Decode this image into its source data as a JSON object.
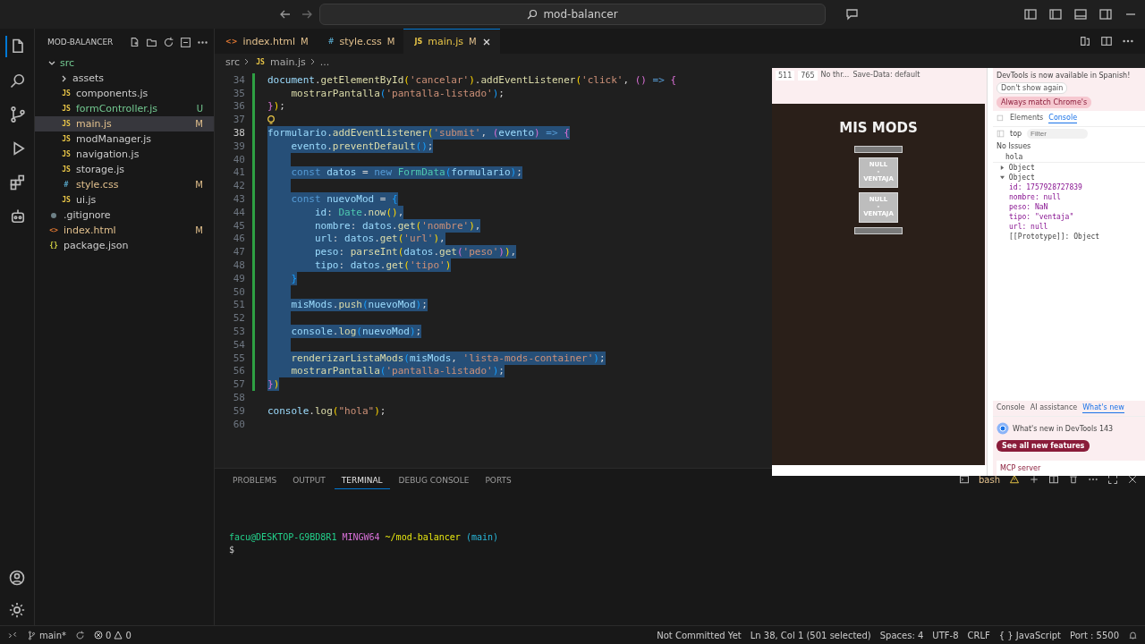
{
  "title_bar": {
    "search": "mod-balancer"
  },
  "activity_bar": {
    "items": [
      {
        "kind": "files",
        "selected": true
      },
      {
        "kind": "search",
        "selected": false
      },
      {
        "kind": "git",
        "selected": false
      },
      {
        "kind": "debug",
        "selected": false
      },
      {
        "kind": "extensions",
        "selected": false
      },
      {
        "kind": "remote",
        "selected": false
      }
    ]
  },
  "explorer": {
    "title": "MOD-BALANCER",
    "tree": [
      {
        "name": "src",
        "kind": "folder",
        "expanded": true,
        "color": "#73c991",
        "selected": false,
        "children": [
          {
            "name": "assets",
            "kind": "folder",
            "expanded": false,
            "color": "#cccccc",
            "selected": false
          },
          {
            "name": "components.js",
            "kind": "file",
            "icon": "JS",
            "color": "#cccccc",
            "selected": false
          },
          {
            "name": "formController.js",
            "kind": "file",
            "icon": "JS",
            "status": "U",
            "color": "#73c991",
            "selected": false
          },
          {
            "name": "main.js",
            "kind": "file",
            "icon": "JS",
            "status": "M",
            "color": "#e2c08d",
            "selected": true
          },
          {
            "name": "modManager.js",
            "kind": "file",
            "icon": "JS",
            "color": "#cccccc",
            "selected": false
          },
          {
            "name": "navigation.js",
            "kind": "file",
            "icon": "JS",
            "color": "#cccccc",
            "selected": false
          },
          {
            "name": "storage.js",
            "kind": "file",
            "icon": "JS",
            "color": "#cccccc",
            "selected": false
          },
          {
            "name": "style.css",
            "kind": "file",
            "icon": "#",
            "status": "M",
            "color": "#e2c08d",
            "selected": false
          },
          {
            "name": "ui.js",
            "kind": "file",
            "icon": "JS",
            "color": "#cccccc",
            "selected": false
          }
        ]
      },
      {
        "name": ".gitignore",
        "kind": "file",
        "color": "#cccccc",
        "selected": false
      },
      {
        "name": "index.html",
        "kind": "file",
        "icon": "<>",
        "status": "M",
        "color": "#e2c08d",
        "selected": false
      },
      {
        "name": "package.json",
        "kind": "file",
        "icon": "{}",
        "color": "#cccccc",
        "selected": false
      }
    ]
  },
  "tabs": [
    {
      "icon": "<>",
      "label": "index.html",
      "status": "M",
      "selected": false
    },
    {
      "icon": "#",
      "label": "style.css",
      "status": "M",
      "selected": false
    },
    {
      "icon": "JS",
      "label": "main.js",
      "status": "M",
      "selected": true
    }
  ],
  "breadcrumb": [
    {
      "label": "src"
    },
    {
      "icon": "JS",
      "label": "main.js"
    },
    {
      "label": "..."
    }
  ],
  "editor": {
    "lines": [
      {
        "number": "34",
        "selected": false,
        "tokens": [
          {
            "text": "document",
            "kind": "variable"
          },
          {
            "text": ".",
            "kind": "punctuation"
          },
          {
            "text": "getElementById",
            "kind": "function"
          },
          {
            "text": "(",
            "kind": "bracket1"
          },
          {
            "text": "'cancelar'",
            "kind": "string"
          },
          {
            "text": ")",
            "kind": "bracket1"
          },
          {
            "text": ".",
            "kind": "punctuation"
          },
          {
            "text": "addEventListener",
            "kind": "function"
          },
          {
            "text": "(",
            "kind": "bracket1"
          },
          {
            "text": "'click'",
            "kind": "string"
          },
          {
            "text": ", ",
            "kind": "punctuation"
          },
          {
            "text": "() ",
            "kind": "bracket2"
          },
          {
            "text": "=> ",
            "kind": "keyword"
          },
          {
            "text": "{",
            "kind": "bracket2"
          }
        ]
      },
      {
        "number": "35",
        "selected": false,
        "tokens": [
          {
            "text": "    mostrarPantalla",
            "kind": "function"
          },
          {
            "text": "(",
            "kind": "bracket3"
          },
          {
            "text": "'pantalla-listado'",
            "kind": "string"
          },
          {
            "text": ")",
            "kind": "bracket3"
          },
          {
            "text": ";",
            "kind": "punctuation"
          }
        ]
      },
      {
        "number": "36",
        "selected": false,
        "tokens": [
          {
            "text": "}",
            "kind": "bracket2"
          },
          {
            "text": ")",
            "kind": "bracket1"
          },
          {
            "text": ";",
            "kind": "punctuation"
          }
        ]
      },
      {
        "number": "37",
        "selected": false,
        "lightbulb": true
      },
      {
        "number": "38",
        "selected": true,
        "tokens": [
          {
            "text": "formulario",
            "kind": "variable"
          },
          {
            "text": ".",
            "kind": "punctuation"
          },
          {
            "text": "addEventListener",
            "kind": "function"
          },
          {
            "text": "(",
            "kind": "bracket1"
          },
          {
            "text": "'submit'",
            "kind": "string"
          },
          {
            "text": ", ",
            "kind": "punctuation"
          },
          {
            "text": "(",
            "kind": "bracket2"
          },
          {
            "text": "evento",
            "kind": "variable"
          },
          {
            "text": ") ",
            "kind": "bracket2"
          },
          {
            "text": "=> ",
            "kind": "keyword"
          },
          {
            "text": "{",
            "kind": "bracket2"
          }
        ]
      },
      {
        "number": "39",
        "selected": true,
        "tokens": [
          {
            "text": "    evento",
            "kind": "variable"
          },
          {
            "text": ".",
            "kind": "punctuation"
          },
          {
            "text": "preventDefault",
            "kind": "function"
          },
          {
            "text": "()",
            "kind": "bracket3"
          },
          {
            "text": ";",
            "kind": "punctuation"
          }
        ]
      },
      {
        "number": "40",
        "selected": true
      },
      {
        "number": "41",
        "selected": true,
        "tokens": [
          {
            "text": "    const ",
            "kind": "keyword"
          },
          {
            "text": "datos",
            "kind": "variable"
          },
          {
            "text": " = ",
            "kind": "punctuation"
          },
          {
            "text": "new ",
            "kind": "keyword"
          },
          {
            "text": "FormData",
            "kind": "class"
          },
          {
            "text": "(",
            "kind": "bracket3"
          },
          {
            "text": "formulario",
            "kind": "variable"
          },
          {
            "text": ")",
            "kind": "bracket3"
          },
          {
            "text": ";",
            "kind": "punctuation"
          }
        ]
      },
      {
        "number": "42",
        "selected": true
      },
      {
        "number": "43",
        "selected": true,
        "tokens": [
          {
            "text": "    const ",
            "kind": "keyword"
          },
          {
            "text": "nuevoMod",
            "kind": "variable"
          },
          {
            "text": " = ",
            "kind": "punctuation"
          },
          {
            "text": "{",
            "kind": "bracket3"
          }
        ]
      },
      {
        "number": "44",
        "selected": true,
        "tokens": [
          {
            "text": "        id",
            "kind": "variable"
          },
          {
            "text": ": ",
            "kind": "punctuation"
          },
          {
            "text": "Date",
            "kind": "class"
          },
          {
            "text": ".",
            "kind": "punctuation"
          },
          {
            "text": "now",
            "kind": "function"
          },
          {
            "text": "()",
            "kind": "bracket1"
          },
          {
            "text": ",",
            "kind": "punctuation"
          }
        ]
      },
      {
        "number": "45",
        "selected": true,
        "tokens": [
          {
            "text": "        nombre",
            "kind": "variable"
          },
          {
            "text": ": ",
            "kind": "punctuation"
          },
          {
            "text": "datos",
            "kind": "variable"
          },
          {
            "text": ".",
            "kind": "punctuation"
          },
          {
            "text": "get",
            "kind": "function"
          },
          {
            "text": "(",
            "kind": "bracket1"
          },
          {
            "text": "'nombre'",
            "kind": "string"
          },
          {
            "text": ")",
            "kind": "bracket1"
          },
          {
            "text": ",",
            "kind": "punctuation"
          }
        ]
      },
      {
        "number": "46",
        "selected": true,
        "tokens": [
          {
            "text": "        url",
            "kind": "variable"
          },
          {
            "text": ": ",
            "kind": "punctuation"
          },
          {
            "text": "datos",
            "kind": "variable"
          },
          {
            "text": ".",
            "kind": "punctuation"
          },
          {
            "text": "get",
            "kind": "function"
          },
          {
            "text": "(",
            "kind": "bracket1"
          },
          {
            "text": "'url'",
            "kind": "string"
          },
          {
            "text": ")",
            "kind": "bracket1"
          },
          {
            "text": ",",
            "kind": "punctuation"
          }
        ]
      },
      {
        "number": "47",
        "selected": true,
        "tokens": [
          {
            "text": "        peso",
            "kind": "variable"
          },
          {
            "text": ": ",
            "kind": "punctuation"
          },
          {
            "text": "parseInt",
            "kind": "function"
          },
          {
            "text": "(",
            "kind": "bracket1"
          },
          {
            "text": "datos",
            "kind": "variable"
          },
          {
            "text": ".",
            "kind": "punctuation"
          },
          {
            "text": "get",
            "kind": "function"
          },
          {
            "text": "(",
            "kind": "bracket2"
          },
          {
            "text": "'peso'",
            "kind": "string"
          },
          {
            "text": ")",
            "kind": "bracket2"
          },
          {
            "text": ")",
            "kind": "bracket1"
          },
          {
            "text": ",",
            "kind": "punctuation"
          }
        ]
      },
      {
        "number": "48",
        "selected": true,
        "tokens": [
          {
            "text": "        tipo",
            "kind": "variable"
          },
          {
            "text": ": ",
            "kind": "punctuation"
          },
          {
            "text": "datos",
            "kind": "variable"
          },
          {
            "text": ".",
            "kind": "punctuation"
          },
          {
            "text": "get",
            "kind": "function"
          },
          {
            "text": "(",
            "kind": "bracket1"
          },
          {
            "text": "'tipo'",
            "kind": "string"
          },
          {
            "text": ")",
            "kind": "bracket1"
          }
        ]
      },
      {
        "number": "49",
        "selected": true,
        "tokens": [
          {
            "text": "    }",
            "kind": "bracket3"
          }
        ]
      },
      {
        "number": "50",
        "selected": true
      },
      {
        "number": "51",
        "selected": true,
        "tokens": [
          {
            "text": "    misMods",
            "kind": "variable"
          },
          {
            "text": ".",
            "kind": "punctuation"
          },
          {
            "text": "push",
            "kind": "function"
          },
          {
            "text": "(",
            "kind": "bracket3"
          },
          {
            "text": "nuevoMod",
            "kind": "variable"
          },
          {
            "text": ")",
            "kind": "bracket3"
          },
          {
            "text": ";",
            "kind": "punctuation"
          }
        ]
      },
      {
        "number": "52",
        "selected": true
      },
      {
        "number": "53",
        "selected": true,
        "tokens": [
          {
            "text": "    console",
            "kind": "variable"
          },
          {
            "text": ".",
            "kind": "punctuation"
          },
          {
            "text": "log",
            "kind": "function"
          },
          {
            "text": "(",
            "kind": "bracket3"
          },
          {
            "text": "nuevoMod",
            "kind": "variable"
          },
          {
            "text": ")",
            "kind": "bracket3"
          },
          {
            "text": ";",
            "kind": "punctuation"
          }
        ]
      },
      {
        "number": "54",
        "selected": true
      },
      {
        "number": "55",
        "selected": true,
        "tokens": [
          {
            "text": "    renderizarListaMods",
            "kind": "function"
          },
          {
            "text": "(",
            "kind": "bracket3"
          },
          {
            "text": "misMods",
            "kind": "variable"
          },
          {
            "text": ", ",
            "kind": "punctuation"
          },
          {
            "text": "'lista-mods-container'",
            "kind": "string"
          },
          {
            "text": ")",
            "kind": "bracket3"
          },
          {
            "text": ";",
            "kind": "punctuation"
          }
        ]
      },
      {
        "number": "56",
        "selected": true,
        "tokens": [
          {
            "text": "    mostrarPantalla",
            "kind": "function"
          },
          {
            "text": "(",
            "kind": "bracket3"
          },
          {
            "text": "'pantalla-listado'",
            "kind": "string"
          },
          {
            "text": ")",
            "kind": "bracket3"
          },
          {
            "text": ";",
            "kind": "punctuation"
          }
        ]
      },
      {
        "number": "57",
        "selected": true,
        "tokens": [
          {
            "text": "}",
            "kind": "bracket2"
          },
          {
            "text": ")",
            "kind": "bracket1"
          }
        ]
      },
      {
        "number": "58",
        "selected": false
      },
      {
        "number": "59",
        "selected": false,
        "tokens": [
          {
            "text": "console",
            "kind": "variable"
          },
          {
            "text": ".",
            "kind": "punctuation"
          },
          {
            "text": "log",
            "kind": "function"
          },
          {
            "text": "(",
            "kind": "bracket1"
          },
          {
            "text": "\"hola\"",
            "kind": "string"
          },
          {
            "text": ")",
            "kind": "bracket1"
          },
          {
            "text": ";",
            "kind": "punctuation"
          }
        ]
      },
      {
        "number": "60",
        "selected": false
      }
    ]
  },
  "panel": {
    "tabs": [
      {
        "label": "PROBLEMS",
        "selected": false
      },
      {
        "label": "OUTPUT",
        "selected": false
      },
      {
        "label": "TERMINAL",
        "selected": true
      },
      {
        "label": "DEBUG CONSOLE",
        "selected": false
      },
      {
        "label": "PORTS",
        "selected": false
      }
    ],
    "shell": "bash",
    "prompt": [
      {
        "text": "facu@DESKTOP-G9BD8R1",
        "kind": "user"
      },
      {
        "text": "MINGW64",
        "kind": "system"
      },
      {
        "text": "~/mod-balancer",
        "kind": "path"
      },
      {
        "text": "(main)",
        "kind": "branch"
      }
    ],
    "cursor_line": "$"
  },
  "browser": {
    "toolbar": [
      {
        "kind": "field",
        "text": "511"
      },
      {
        "kind": "field",
        "text": "765"
      },
      {
        "kind": "menu",
        "text": "No thr..."
      },
      {
        "kind": "menu",
        "text": "Save-Data: default"
      }
    ],
    "page": {
      "title": "MIS MODS",
      "mods": [
        {
          "name": "NULL",
          "sep": "-",
          "type": "VENTAJA"
        },
        {
          "name": "NULL",
          "sep": "-",
          "type": "VENTAJA"
        }
      ]
    },
    "devtools": {
      "notice": "DevTools is now available in Spanish!",
      "notice_buttons": [
        {
          "label": "Don't show again",
          "kind": "plain"
        },
        {
          "label": "Always match Chrome's",
          "kind": "primary"
        }
      ],
      "tabs": [
        {
          "label": "Elements",
          "selected": false
        },
        {
          "label": "Console",
          "selected": true
        }
      ],
      "context": "top",
      "filter": {
        "placeholder": "Filter"
      },
      "issues": "No Issues",
      "console": [
        {
          "text": "hola",
          "kind": "log"
        },
        {
          "text": "Object",
          "kind": "collapsed"
        },
        {
          "text": "Object",
          "kind": "expanded"
        },
        {
          "text": "id: 1757928727839",
          "kind": "prop"
        },
        {
          "text": "nombre: null",
          "kind": "prop"
        },
        {
          "text": "peso: NaN",
          "kind": "prop"
        },
        {
          "text": "tipo: \"ventaja\"",
          "kind": "prop"
        },
        {
          "text": "url: null",
          "kind": "prop"
        },
        {
          "text": "[[Prototype]]: Object",
          "kind": "proto"
        }
      ],
      "drawer_tabs": [
        {
          "label": "Console",
          "selected": false
        },
        {
          "label": "AI assistance",
          "selected": false
        },
        {
          "label": "What's new",
          "selected": true
        }
      ],
      "whats_new": "What's new in DevTools 143",
      "whats_new_button": "See all new features",
      "card": "MCP server"
    }
  },
  "status_bar": {
    "branch": "main*",
    "errors": "0",
    "warnings": "0",
    "items": [
      "Not Committed Yet",
      "Ln 38, Col 1 (501 selected)",
      "Spaces: 4",
      "UTF-8",
      "CRLF",
      "{ } JavaScript",
      "Port : 5500"
    ]
  }
}
